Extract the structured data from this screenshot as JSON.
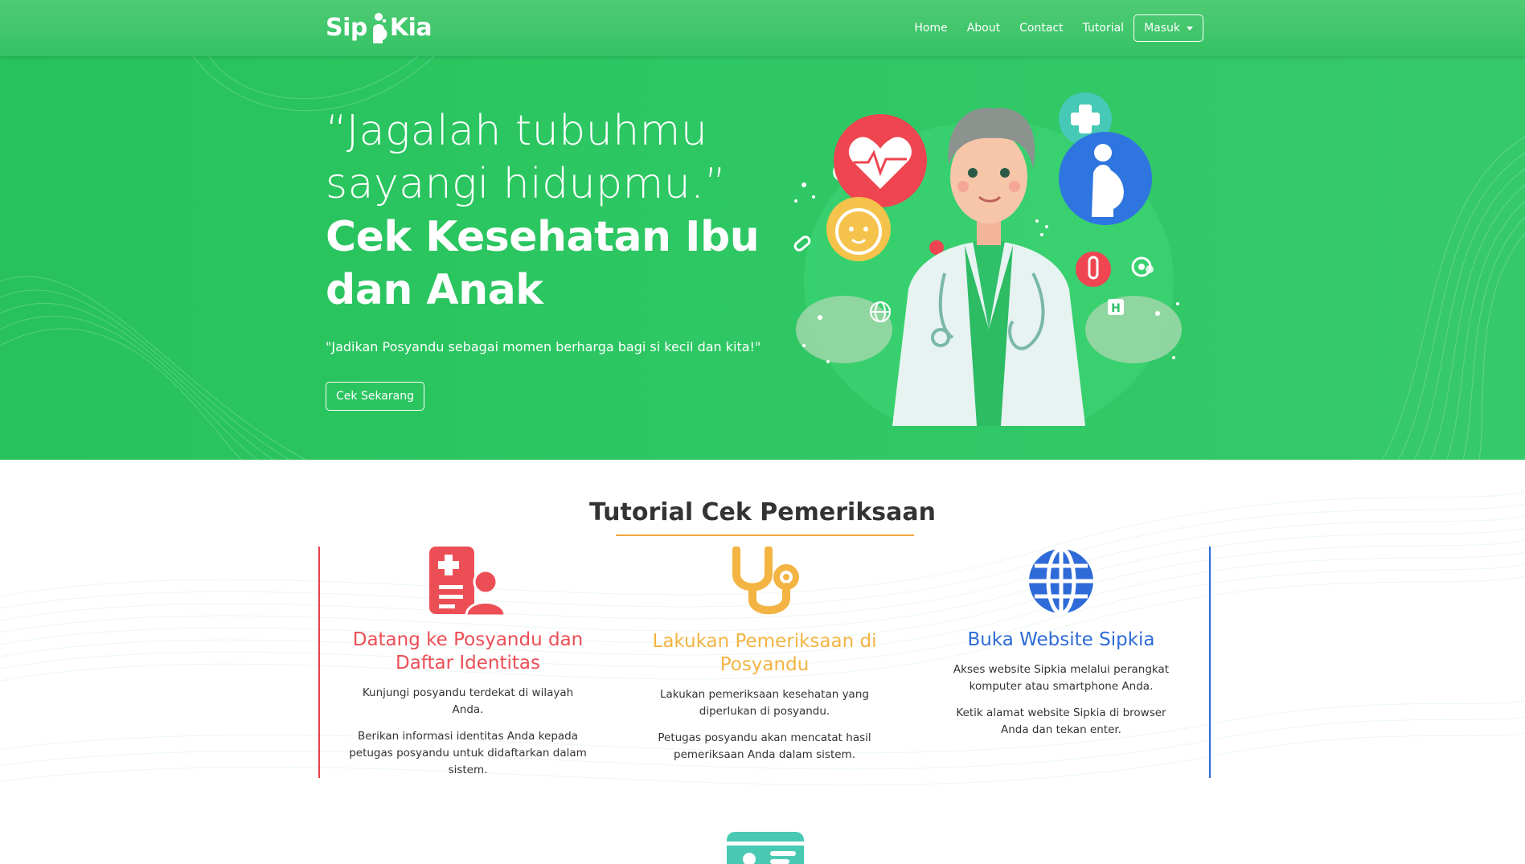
{
  "navbar": {
    "brand": "SipKia",
    "brand_prefix": "Sip",
    "brand_suffix": "Kia",
    "links": [
      {
        "label": "Home"
      },
      {
        "label": "About"
      },
      {
        "label": "Contact"
      },
      {
        "label": "Tutorial"
      }
    ],
    "dropdown_label": "Masuk"
  },
  "hero": {
    "quote_line1": "“Jagalah tubuhmu",
    "quote_line2": "sayangi hidupmu.”",
    "headline_line1": "Cek Kesehatan Ibu",
    "headline_line2": "dan Anak",
    "subtitle": "\"Jadikan Posyandu sebagai momen berharga bagi si kecil dan kita!\"",
    "button_label": "Cek Sekarang"
  },
  "tutorial": {
    "title": "Tutorial Cek Pemeriksaan",
    "cards": [
      {
        "icon": "hospital-user-icon",
        "title": "Datang ke Posyandu dan Daftar Identitas",
        "paragraphs": [
          "Kunjungi posyandu terdekat di wilayah Anda.",
          "Berikan informasi identitas Anda kepada petugas posyandu untuk didaftarkan dalam sistem."
        ]
      },
      {
        "icon": "stethoscope-icon",
        "title": "Lakukan Pemeriksaan di Posyandu",
        "paragraphs": [
          "Lakukan pemeriksaan kesehatan yang diperlukan di posyandu.",
          "Petugas posyandu akan mencatat hasil pemeriksaan Anda dalam sistem."
        ]
      },
      {
        "icon": "globe-icon",
        "title": "Buka Website Sipkia",
        "paragraphs": [
          "Akses website Sipkia melalui perangkat komputer atau smartphone Anda.",
          "Ketik alamat website Sipkia di browser Anda dan tekan enter."
        ]
      }
    ]
  },
  "colors": {
    "primary_green": "#2dc763",
    "card1_accent": "#ec4e56",
    "card2_accent": "#f3b443",
    "card3_accent": "#2f6bd8",
    "title_underline": "#f0a73a"
  }
}
